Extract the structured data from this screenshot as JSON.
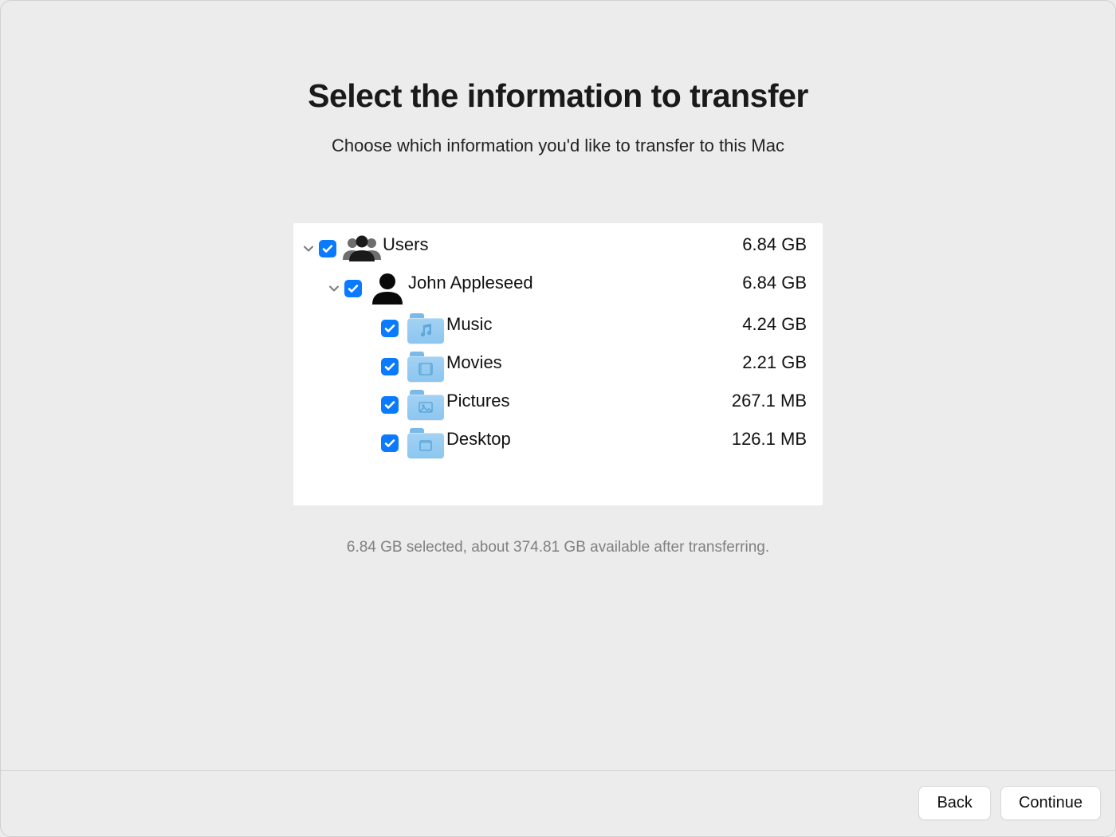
{
  "header": {
    "title": "Select the information to transfer",
    "subtitle": "Choose which information you'd like to transfer to this Mac"
  },
  "tree": {
    "root": {
      "label": "Users",
      "size": "6.84 GB"
    },
    "user": {
      "label": "John Appleseed",
      "size": "6.84 GB"
    },
    "items": [
      {
        "label": "Music",
        "size": "4.24 GB",
        "icon": "music"
      },
      {
        "label": "Movies",
        "size": "2.21 GB",
        "icon": "movies"
      },
      {
        "label": "Pictures",
        "size": "267.1 MB",
        "icon": "pictures"
      },
      {
        "label": "Desktop",
        "size": "126.1 MB",
        "icon": "desktop"
      }
    ]
  },
  "status": "6.84 GB selected, about 374.81 GB available after transferring.",
  "buttons": {
    "back": "Back",
    "continue": "Continue"
  }
}
